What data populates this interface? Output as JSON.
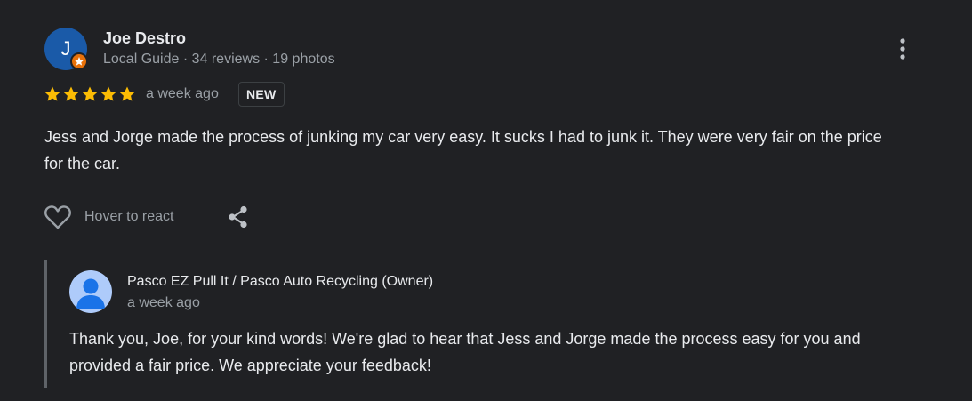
{
  "reviewer": {
    "initial": "J",
    "name": "Joe Destro",
    "meta": "Local Guide · 34 reviews · 19 photos",
    "avatar_color": "#1a5aa8",
    "badge_color": "#e8710a"
  },
  "rating": {
    "stars": 5,
    "max_stars": 5,
    "star_color": "#fbbc04",
    "time": "a week ago",
    "badge": "NEW"
  },
  "review": {
    "text": "Jess and Jorge made the process of junking my car very easy. It sucks I had to junk it. They were very fair on the price for the car."
  },
  "actions": {
    "react_icon": "heart-outline-icon",
    "react_label": "Hover to react",
    "share_icon": "share-icon",
    "more_icon": "more-vertical-icon"
  },
  "owner_reply": {
    "name": "Pasco EZ Pull It / Pasco Auto Recycling (Owner)",
    "time": "a week ago",
    "text": "Thank you, Joe, for your kind words! We're glad to hear that Jess and Jorge made the process easy for you and provided a fair price. We appreciate your feedback!",
    "avatar_icon": "default-person-avatar-icon",
    "avatar_bg": "#aecbfa",
    "avatar_fg": "#1a73e8"
  }
}
